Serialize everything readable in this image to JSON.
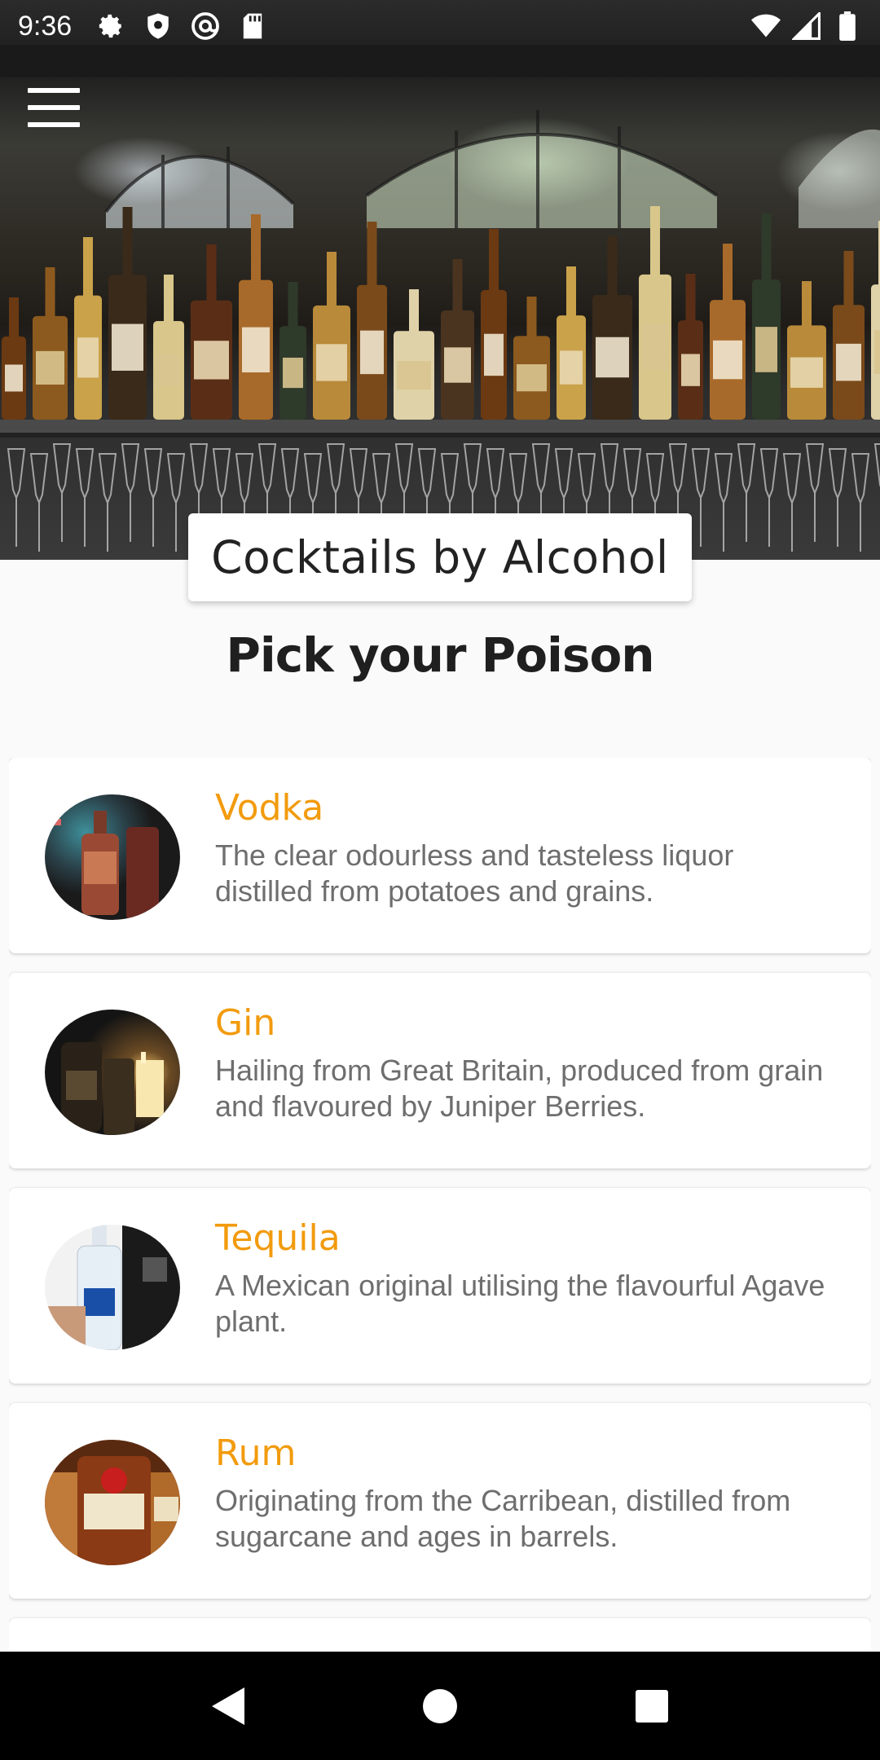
{
  "status_bar": {
    "time": "9:36",
    "icons_left": [
      "gear-icon",
      "shield-icon",
      "at-sign-icon",
      "sd-card-icon"
    ],
    "icons_right": [
      "wifi-icon",
      "cell-signal-icon",
      "battery-icon"
    ]
  },
  "hero": {
    "image": "bar-shelf-bottles-photo",
    "title": "Cocktails by Alcohol"
  },
  "heading": "Pick your Poison",
  "accent_color": "#f29b0d",
  "items": [
    {
      "name": "Vodka",
      "description": "The clear odourless and tasteless liquor distilled from potatoes and grains.",
      "image": "vodka-bottle-photo"
    },
    {
      "name": "Gin",
      "description": "Hailing from Great Britain, produced from grain and flavoured by Juniper Berries.",
      "image": "gin-bottle-photo"
    },
    {
      "name": "Tequila",
      "description": "A Mexican original utilising the flavourful Agave plant.",
      "image": "tequila-bottle-photo"
    },
    {
      "name": "Rum",
      "description": "Originating from the Carribean, distilled from sugarcane and ages in barrels.",
      "image": "rum-bottle-photo"
    }
  ],
  "nav_bar": {
    "buttons": [
      "back-icon",
      "home-icon",
      "recents-icon"
    ]
  }
}
